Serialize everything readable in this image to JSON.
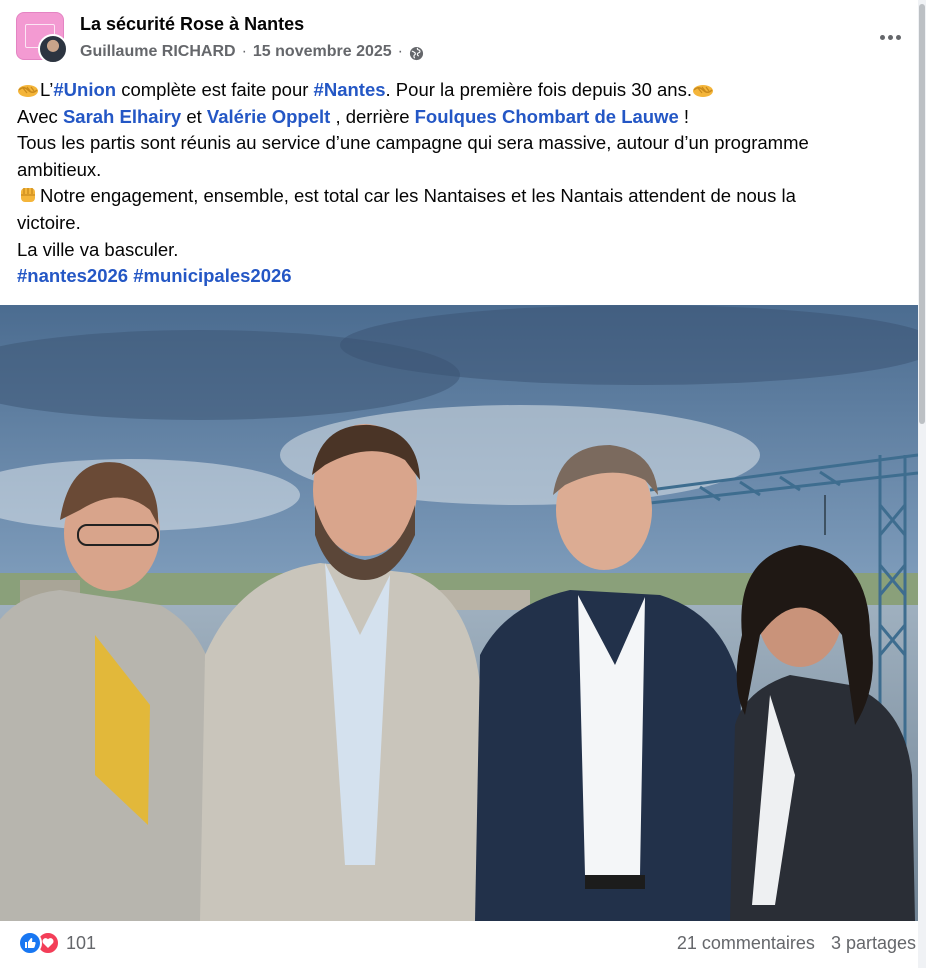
{
  "post": {
    "page_name": "La sécurité Rose à Nantes",
    "author": "Guillaume RICHARD",
    "separator": "·",
    "date": "15 novembre 2025",
    "audience_icon": "globe-icon",
    "more_icon": "more-horizontal-icon",
    "body": {
      "line1_pre": "L’",
      "line1_tag1": "#Union",
      "line1_mid": " complète est faite pour ",
      "line1_tag2": "#Nantes",
      "line1_post": ". Pour la première fois depuis 30 ans.",
      "line2_pre": "Avec ",
      "line2_mention1": "Sarah Elhairy",
      "line2_mid1": " et ",
      "line2_mention2": "Valérie Oppelt",
      "line2_mid2": " , derrière ",
      "line2_mention3": "Foulques Chombart de Lauwe",
      "line2_post": " !",
      "line3": "Tous les partis sont réunis au service d’une campagne qui sera massive, autour d’un programme",
      "line4": "ambitieux.",
      "line5": "Notre engagement, ensemble, est total car les Nantaises et les Nantais attendent de nous la",
      "line6": "victoire.",
      "line7": "La ville va basculer.",
      "hashtag1": "#nantes2026",
      "hashtag2": "#municipales2026",
      "emojis": [
        "handshake-emoji",
        "handshake-emoji",
        "raised-fist-emoji"
      ]
    },
    "photo": {
      "description_icon": "group-photo-image"
    },
    "footer": {
      "reaction_icons": [
        "like-icon",
        "love-icon"
      ],
      "reaction_count": "101",
      "comments": "21 commentaires",
      "shares": "3 partages"
    }
  },
  "colors": {
    "link": "#2457c5",
    "meta_gray": "#65676b",
    "like_blue": "#1877f2",
    "love_red": "#f33e58",
    "page_avatar_pink": "#f39ad2"
  }
}
